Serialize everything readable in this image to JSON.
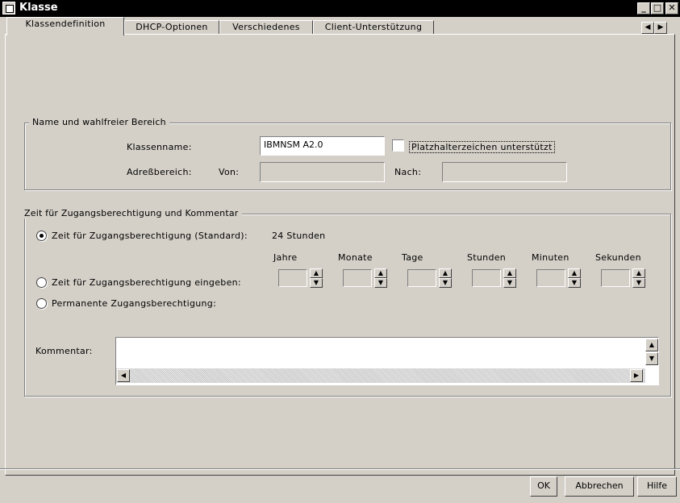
{
  "window": {
    "title": "Klasse",
    "minimize": "_",
    "maximize": "□",
    "close": "✕"
  },
  "tabs": [
    {
      "label": "Klassendefinition",
      "active": true
    },
    {
      "label": "DHCP-Optionen"
    },
    {
      "label": "Verschiedenes"
    },
    {
      "label": "Client-Unterstützung"
    }
  ],
  "tab_scroll": {
    "left": "◀",
    "right": "▶"
  },
  "name_group": {
    "legend": "Name und wahlfreier Bereich",
    "class_name_label": "Klassenname:",
    "class_name_value": "IBMNSM A2.0",
    "wildcard_label": "Platzhalterzeichen unterstützt",
    "wildcard_checked": false,
    "address_range_label": "Adreßbereich:",
    "from_label": "Von:",
    "from_value": "",
    "to_label": "Nach:",
    "to_value": ""
  },
  "lease_group": {
    "legend": "Zeit für Zugangsberechtigung und Kommentar",
    "option_default_label": "Zeit für Zugangsberechtigung (Standard):",
    "option_default_value": "24 Stunden",
    "option_custom_label": "Zeit für Zugangsberechtigung eingeben:",
    "option_permanent_label": "Permanente Zugangsberechtigung:",
    "selected": "default",
    "units": [
      "Jahre",
      "Monate",
      "Tage",
      "Stunden",
      "Minuten",
      "Sekunden"
    ],
    "comment_label": "Kommentar:",
    "comment_value": ""
  },
  "buttons": {
    "ok": "OK",
    "cancel": "Abbrechen",
    "help": "Hilfe"
  }
}
